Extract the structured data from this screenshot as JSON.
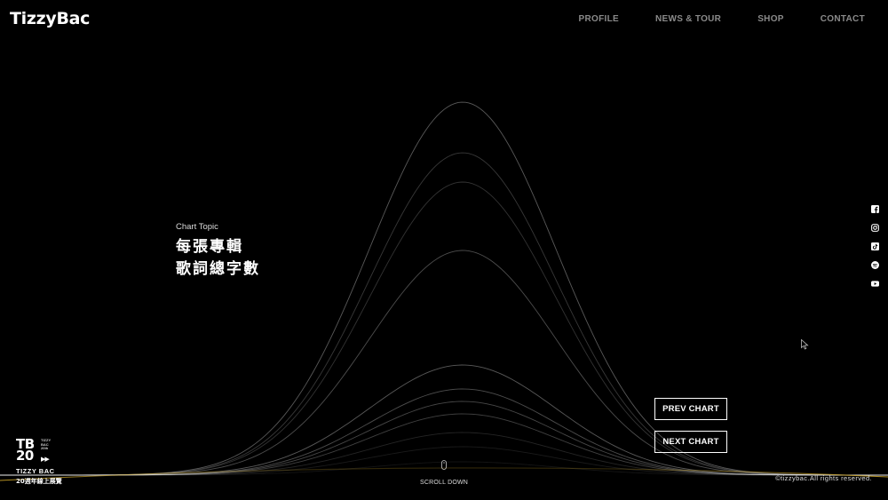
{
  "header": {
    "logo": "TizzyBac",
    "nav": [
      "PROFILE",
      "NEWS & TOUR",
      "SHOP",
      "CONTACT"
    ]
  },
  "topic": {
    "label": "Chart Topic",
    "title_line1": "每張專輯",
    "title_line2": "歌詞總字數"
  },
  "buttons": {
    "prev": "PREV CHART",
    "next": "NEXT CHART"
  },
  "social": [
    "facebook-icon",
    "instagram-icon",
    "tiktok-icon",
    "spotify-icon",
    "youtube-icon"
  ],
  "badge": {
    "mark_line1": "TB",
    "mark_line2": "20",
    "small": [
      "TIZZY",
      "BAC",
      "20th"
    ],
    "name": "TIZZY BAC",
    "subtitle": "20週年線上展覽"
  },
  "scroll": {
    "label": "SCROLL DOWN"
  },
  "footer": {
    "copyright": "©tizzybac.All rights reserved."
  },
  "colors": {
    "background": "#000000",
    "curve": "#ffffff",
    "baseline_gold": "#c9a227",
    "nav": "#8a8a8a"
  }
}
